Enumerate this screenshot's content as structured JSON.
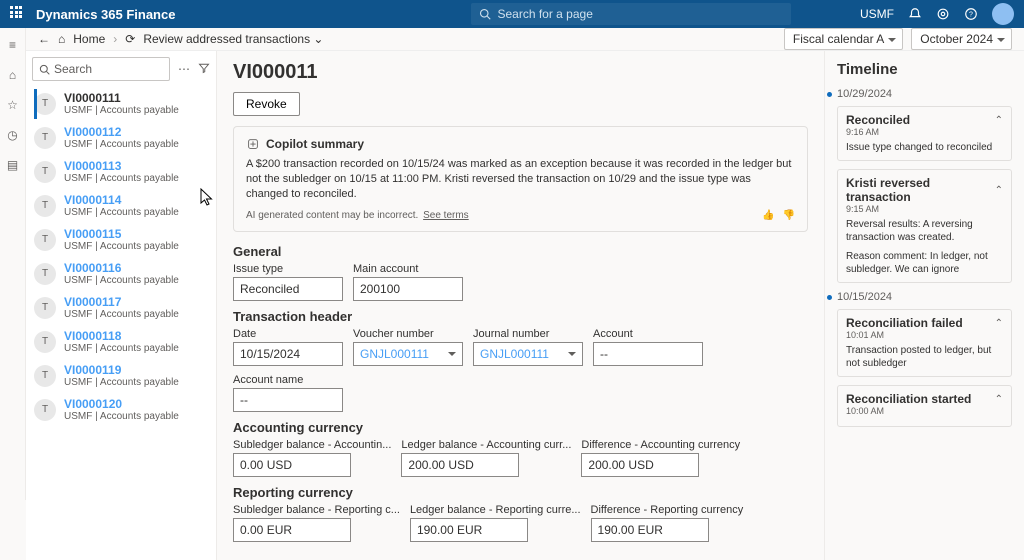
{
  "topbar": {
    "app_title": "Dynamics 365 Finance",
    "search_placeholder": "Search for a page",
    "company": "USMF"
  },
  "nav": {
    "home": "Home",
    "crumb": "Review addressed transactions",
    "fiscal": "Fiscal calendar A",
    "period": "October 2024"
  },
  "search_label": "Search",
  "list": [
    {
      "id": "VI0000111",
      "sub": "USMF | Accounts payable",
      "active": true
    },
    {
      "id": "VI0000112",
      "sub": "USMF | Accounts payable"
    },
    {
      "id": "VI0000113",
      "sub": "USMF | Accounts payable"
    },
    {
      "id": "VI0000114",
      "sub": "USMF | Accounts payable"
    },
    {
      "id": "VI0000115",
      "sub": "USMF | Accounts payable"
    },
    {
      "id": "VI0000116",
      "sub": "USMF | Accounts payable"
    },
    {
      "id": "VI0000117",
      "sub": "USMF | Accounts payable"
    },
    {
      "id": "VI0000118",
      "sub": "USMF | Accounts payable"
    },
    {
      "id": "VI0000119",
      "sub": "USMF | Accounts payable"
    },
    {
      "id": "VI0000120",
      "sub": "USMF | Accounts payable"
    }
  ],
  "main": {
    "title": "VI000011",
    "revoke": "Revoke",
    "copilot_title": "Copilot summary",
    "copilot_body": "A $200 transaction recorded on 10/15/24 was marked as an exception because it was recorded in the ledger but not the subledger on 10/15 at 11:00 PM. Kristi reversed the transaction on 10/29 and the issue type was changed to reconciled.",
    "copilot_disclaimer": "AI generated content may be incorrect.",
    "copilot_terms": "See terms",
    "sections": {
      "general": "General",
      "trans_header": "Transaction header",
      "acct_curr": "Accounting currency",
      "rep_curr": "Reporting currency"
    },
    "fields": {
      "issue_type_l": "Issue type",
      "issue_type_v": "Reconciled",
      "main_account_l": "Main account",
      "main_account_v": "200100",
      "date_l": "Date",
      "date_v": "10/15/2024",
      "voucher_l": "Voucher number",
      "voucher_v": "GNJL000111",
      "journal_l": "Journal number",
      "journal_v": "GNJL000111",
      "account_l": "Account",
      "account_v": "--",
      "accname_l": "Account name",
      "accname_v": "--",
      "sub_acc_l": "Subledger balance - Accountin...",
      "sub_acc_v": "0.00 USD",
      "led_acc_l": "Ledger balance - Accounting curr...",
      "led_acc_v": "200.00 USD",
      "diff_acc_l": "Difference - Accounting currency",
      "diff_acc_v": "200.00 USD",
      "sub_rep_l": "Subledger balance - Reporting c...",
      "sub_rep_v": "0.00 EUR",
      "led_rep_l": "Ledger balance - Reporting curre...",
      "led_rep_v": "190.00 EUR",
      "diff_rep_l": "Difference - Reporting currency",
      "diff_rep_v": "190.00 EUR"
    }
  },
  "timeline": {
    "title": "Timeline",
    "d1": "10/29/2024",
    "d2": "10/15/2024",
    "cards": [
      {
        "title": "Reconciled",
        "time": "9:16 AM",
        "body": "Issue type changed to reconciled"
      },
      {
        "title": "Kristi reversed transaction",
        "time": "9:15 AM",
        "body": "Reversal results: A reversing transaction was created.",
        "body2": "Reason comment: In ledger, not subledger. We can ignore"
      },
      {
        "title": "Reconciliation failed",
        "time": "10:01 AM",
        "body": "Transaction posted to ledger, but not subledger"
      },
      {
        "title": "Reconciliation started",
        "time": "10:00 AM"
      }
    ]
  }
}
